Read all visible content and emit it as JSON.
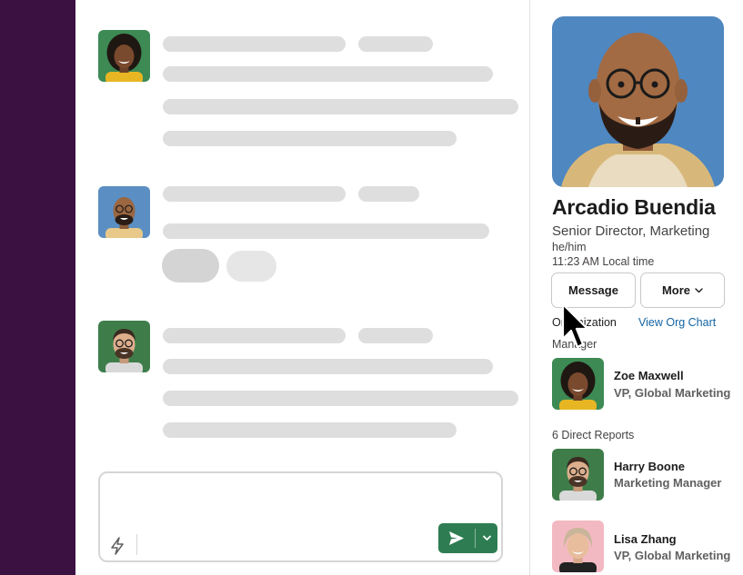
{
  "colors": {
    "sidebar": "#3a1140",
    "skeleton": "#dedede",
    "send_button": "#2e7d52",
    "link": "#1264a3"
  },
  "composer": {
    "shortcut_icon": "lightning-bolt-icon",
    "send_icon": "send-icon",
    "options_icon": "chevron-down-icon"
  },
  "profile": {
    "name": "Arcadio Buendia",
    "title": "Senior Director, Marketing",
    "pronouns": "he/him",
    "local_time": "11:23 AM Local time",
    "message_label": "Message",
    "more_label": "More",
    "org_label": "Organization",
    "org_chart_link": "View Org Chart",
    "manager_label": "Manager",
    "manager": {
      "name": "Zoe Maxwell",
      "role": "VP, Global Marketing"
    },
    "direct_reports_label": "6 Direct Reports",
    "direct_reports": [
      {
        "name": "Harry Boone",
        "role": "Marketing Manager"
      },
      {
        "name": "Lisa Zhang",
        "role": "VP, Global Marketing"
      }
    ]
  }
}
